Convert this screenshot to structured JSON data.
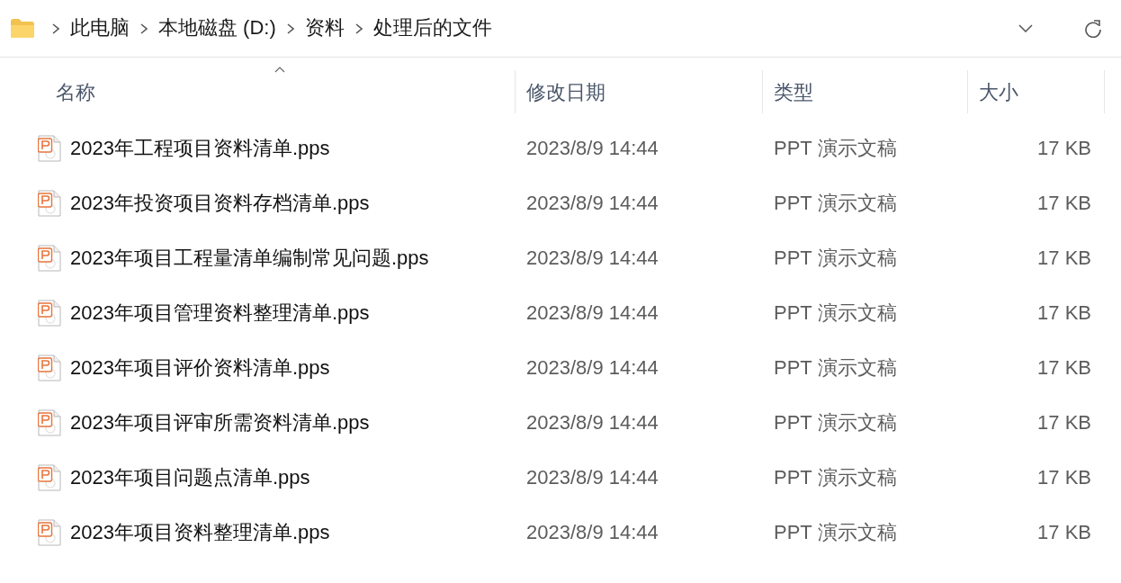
{
  "address_bar": {
    "breadcrumbs": [
      "此电脑",
      "本地磁盘 (D:)",
      "资料",
      "处理后的文件"
    ]
  },
  "columns": [
    {
      "label": "名称",
      "sorted": true
    },
    {
      "label": "修改日期",
      "sorted": false
    },
    {
      "label": "类型",
      "sorted": false
    },
    {
      "label": "大小",
      "sorted": false
    }
  ],
  "files": [
    {
      "name": "2023年工程项目资料清单.pps",
      "modified": "2023/8/9 14:44",
      "type": "PPT 演示文稿",
      "size": "17 KB"
    },
    {
      "name": "2023年投资项目资料存档清单.pps",
      "modified": "2023/8/9 14:44",
      "type": "PPT 演示文稿",
      "size": "17 KB"
    },
    {
      "name": "2023年项目工程量清单编制常见问题.pps",
      "modified": "2023/8/9 14:44",
      "type": "PPT 演示文稿",
      "size": "17 KB"
    },
    {
      "name": "2023年项目管理资料整理清单.pps",
      "modified": "2023/8/9 14:44",
      "type": "PPT 演示文稿",
      "size": "17 KB"
    },
    {
      "name": "2023年项目评价资料清单.pps",
      "modified": "2023/8/9 14:44",
      "type": "PPT 演示文稿",
      "size": "17 KB"
    },
    {
      "name": "2023年项目评审所需资料清单.pps",
      "modified": "2023/8/9 14:44",
      "type": "PPT 演示文稿",
      "size": "17 KB"
    },
    {
      "name": "2023年项目问题点清单.pps",
      "modified": "2023/8/9 14:44",
      "type": "PPT 演示文稿",
      "size": "17 KB"
    },
    {
      "name": "2023年项目资料整理清单.pps",
      "modified": "2023/8/9 14:44",
      "type": "PPT 演示文稿",
      "size": "17 KB"
    }
  ]
}
